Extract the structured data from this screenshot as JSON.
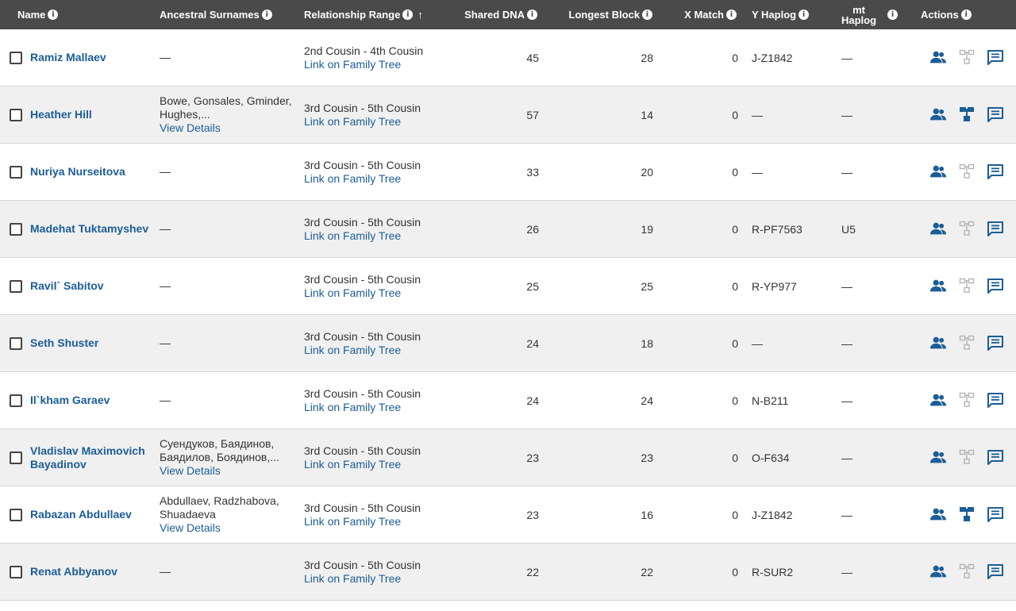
{
  "colors": {
    "header_bg": "#4a4a4a",
    "link": "#1b5d96",
    "row_alt": "#f0f0f0",
    "icon_active": "#1b5d96",
    "icon_inactive": "#b5b5b5"
  },
  "columns": {
    "name": "Name",
    "surnames": "Ancestral Surnames",
    "relationship": "Relationship Range",
    "shared_dna": "Shared DNA",
    "longest_block": "Longest Block",
    "x_match": "X Match",
    "y_haplog": "Y Haplog",
    "mt_haplog_line1": "mt",
    "mt_haplog_line2": "Haplog",
    "actions": "Actions",
    "info_glyph": "i",
    "sort_arrow": "↑"
  },
  "rows": [
    {
      "name": "Ramiz Mallaev",
      "surnames": "—",
      "surnames_link": "",
      "relationship": "2nd Cousin - 4th Cousin",
      "tree_link": "Link on Family Tree",
      "shared_dna": "45",
      "longest_block": "28",
      "x_match": "0",
      "y_haplog": "J-Z1842",
      "mt_haplog": "—",
      "tree_icon_active": false
    },
    {
      "name": "Heather Hill",
      "surnames": "Bowe, Gonsales, Gminder, Hughes,...",
      "surnames_link": "View Details",
      "relationship": "3rd Cousin - 5th Cousin",
      "tree_link": "Link on Family Tree",
      "shared_dna": "57",
      "longest_block": "14",
      "x_match": "0",
      "y_haplog": "—",
      "mt_haplog": "—",
      "tree_icon_active": true
    },
    {
      "name": "Nuriya Nurseitova",
      "surnames": "—",
      "surnames_link": "",
      "relationship": "3rd Cousin - 5th Cousin",
      "tree_link": "Link on Family Tree",
      "shared_dna": "33",
      "longest_block": "20",
      "x_match": "0",
      "y_haplog": "—",
      "mt_haplog": "—",
      "tree_icon_active": false
    },
    {
      "name": "Madehat Tuktamyshev",
      "surnames": "—",
      "surnames_link": "",
      "relationship": "3rd Cousin - 5th Cousin",
      "tree_link": "Link on Family Tree",
      "shared_dna": "26",
      "longest_block": "19",
      "x_match": "0",
      "y_haplog": "R-PF7563",
      "mt_haplog": "U5",
      "tree_icon_active": false
    },
    {
      "name": "Ravil` Sabitov",
      "surnames": "—",
      "surnames_link": "",
      "relationship": "3rd Cousin - 5th Cousin",
      "tree_link": "Link on Family Tree",
      "shared_dna": "25",
      "longest_block": "25",
      "x_match": "0",
      "y_haplog": "R-YP977",
      "mt_haplog": "—",
      "tree_icon_active": false
    },
    {
      "name": "Seth Shuster",
      "surnames": "—",
      "surnames_link": "",
      "relationship": "3rd Cousin - 5th Cousin",
      "tree_link": "Link on Family Tree",
      "shared_dna": "24",
      "longest_block": "18",
      "x_match": "0",
      "y_haplog": "—",
      "mt_haplog": "—",
      "tree_icon_active": false
    },
    {
      "name": "Il`kham Garaev",
      "surnames": "—",
      "surnames_link": "",
      "relationship": "3rd Cousin - 5th Cousin",
      "tree_link": "Link on Family Tree",
      "shared_dna": "24",
      "longest_block": "24",
      "x_match": "0",
      "y_haplog": "N-B211",
      "mt_haplog": "—",
      "tree_icon_active": false
    },
    {
      "name": "Vladislav Maximovich Bayadinov",
      "surnames": "Суендуков, Баядинов, Баядилов, Боядинов,...",
      "surnames_link": "View Details",
      "relationship": "3rd Cousin - 5th Cousin",
      "tree_link": "Link on Family Tree",
      "shared_dna": "23",
      "longest_block": "23",
      "x_match": "0",
      "y_haplog": "O-F634",
      "mt_haplog": "—",
      "tree_icon_active": false
    },
    {
      "name": "Rabazan Abdullaev",
      "surnames": "Abdullaev, Radzhabova, Shuadaeva",
      "surnames_link": "View Details",
      "relationship": "3rd Cousin - 5th Cousin",
      "tree_link": "Link on Family Tree",
      "shared_dna": "23",
      "longest_block": "16",
      "x_match": "0",
      "y_haplog": "J-Z1842",
      "mt_haplog": "—",
      "tree_icon_active": true
    },
    {
      "name": "Renat Abbyanov",
      "surnames": "—",
      "surnames_link": "",
      "relationship": "3rd Cousin - 5th Cousin",
      "tree_link": "Link on Family Tree",
      "shared_dna": "22",
      "longest_block": "22",
      "x_match": "0",
      "y_haplog": "R-SUR2",
      "mt_haplog": "—",
      "tree_icon_active": false
    }
  ]
}
